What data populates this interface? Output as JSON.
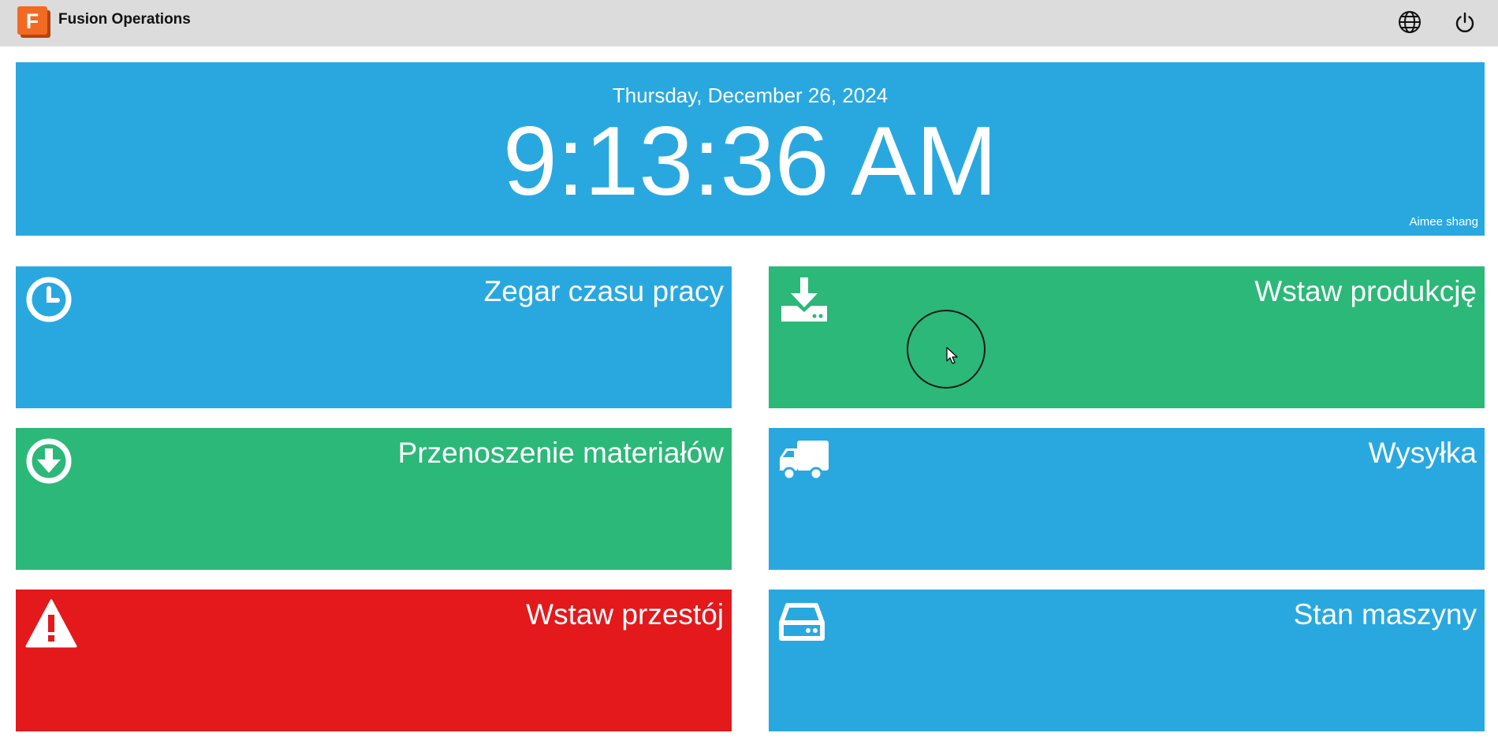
{
  "app": {
    "title": "Fusion Operations",
    "logo_letter": "F"
  },
  "topbar": {
    "language_icon": "globe-icon",
    "power_icon": "power-icon"
  },
  "clock": {
    "date": "Thursday, December 26, 2024",
    "time": "9:13:36 AM",
    "user": "Aimee shang"
  },
  "tiles": [
    {
      "label": "Zegar czasu pracy",
      "icon": "clock-icon",
      "color": "#29a8e0"
    },
    {
      "label": "Wstaw produkcję",
      "icon": "download-tray-icon",
      "color": "#2bb878"
    },
    {
      "label": "Przenoszenie materiałów",
      "icon": "arrow-down-circle-icon",
      "color": "#2bb878"
    },
    {
      "label": "Wysyłka",
      "icon": "truck-icon",
      "color": "#29a8e0"
    },
    {
      "label": "Wstaw przestój",
      "icon": "warning-icon",
      "color": "#e3191c"
    },
    {
      "label": "Stan maszyny",
      "icon": "hard-drive-icon",
      "color": "#29a8e0"
    }
  ],
  "colors": {
    "topbar_bg": "#dcdcdc",
    "blue": "#29a8e0",
    "green": "#2bb878",
    "red": "#e3191c",
    "logo_orange": "#f26a21"
  }
}
